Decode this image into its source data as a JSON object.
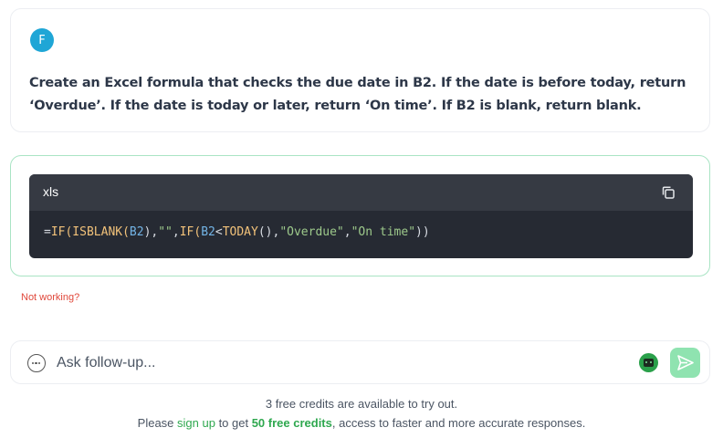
{
  "prompt": {
    "avatar_initial": "F",
    "text": "Create an Excel formula that checks the due date in B2. If the date is before today, return ‘Overdue’. If the date is today or later, return ‘On time’. If B2 is blank, return blank."
  },
  "answer": {
    "code_language": "xls",
    "code_tokens": [
      {
        "t": "=",
        "c": "op"
      },
      {
        "t": "IF(ISBLANK(",
        "c": "fn"
      },
      {
        "t": "B2",
        "c": "ref"
      },
      {
        "t": "),",
        "c": "op"
      },
      {
        "t": "\"\"",
        "c": "str"
      },
      {
        "t": ",",
        "c": "op"
      },
      {
        "t": "IF(",
        "c": "fn"
      },
      {
        "t": "B2",
        "c": "ref"
      },
      {
        "t": "<",
        "c": "op"
      },
      {
        "t": "TODAY",
        "c": "fn"
      },
      {
        "t": "(),",
        "c": "op"
      },
      {
        "t": "\"Overdue\"",
        "c": "str"
      },
      {
        "t": ",",
        "c": "op"
      },
      {
        "t": "\"On time\"",
        "c": "str"
      },
      {
        "t": "))",
        "c": "op"
      }
    ]
  },
  "feedback": {
    "not_working_label": "Not working?"
  },
  "followup": {
    "placeholder": "Ask follow-up..."
  },
  "footer": {
    "line1": "3 free credits are available to try out.",
    "line2_prefix": "Please ",
    "sign_up_link": "sign up",
    "line2_mid": " to get ",
    "credits_bold": "50 free credits",
    "line2_suffix": ", access to faster and more accurate responses."
  },
  "colors": {
    "accent_green": "#2fa84f",
    "answer_border": "#a9e4c4",
    "avatar_blue": "#1fa6d6",
    "error_red": "#e0483b"
  }
}
